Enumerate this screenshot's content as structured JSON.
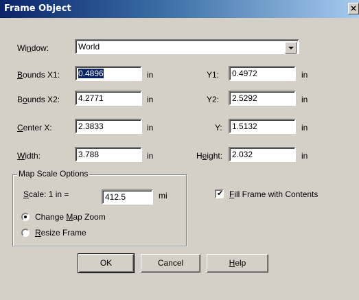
{
  "dialog": {
    "title": "Frame Object",
    "close_glyph": "×"
  },
  "window": {
    "label_pre": "Wi",
    "label_key": "n",
    "label_post": "dow:",
    "value": "World"
  },
  "bounds_x1": {
    "label_key": "B",
    "label_post": "ounds X1:",
    "value": "0.4896",
    "unit": "in"
  },
  "y1": {
    "label": "Y1:",
    "value": "0.4972",
    "unit": "in"
  },
  "bounds_x2": {
    "label_pre": "B",
    "label_key": "o",
    "label_post": "unds X2:",
    "value": "4.2771",
    "unit": "in"
  },
  "y2": {
    "label": "Y2:",
    "value": "2.5292",
    "unit": "in"
  },
  "center_x": {
    "label_key": "C",
    "label_post": "enter X:",
    "value": "2.3833",
    "unit": "in"
  },
  "center_y": {
    "label": "Y:",
    "value": "1.5132",
    "unit": "in"
  },
  "width": {
    "label_key": "W",
    "label_post": "idth:",
    "value": "3.788",
    "unit": "in"
  },
  "height": {
    "label_pre": "H",
    "label_key": "e",
    "label_post": "ight:",
    "value": "2.032",
    "unit": "in"
  },
  "map_scale": {
    "group_title": "Map Scale Options",
    "scale_label_key": "S",
    "scale_label_post": "cale: 1 in =",
    "scale_value": "412.5",
    "scale_unit": "mi",
    "radio_change_pre": "Change ",
    "radio_change_key": "M",
    "radio_change_post": "ap Zoom",
    "radio_resize_key": "R",
    "radio_resize_post": "esize Frame",
    "selected": "change"
  },
  "fill_frame": {
    "key": "F",
    "post": "ill Frame with Contents",
    "checked": true,
    "check_glyph": "✔"
  },
  "buttons": {
    "ok": "OK",
    "cancel": "Cancel",
    "help_key": "H",
    "help_post": "elp"
  }
}
